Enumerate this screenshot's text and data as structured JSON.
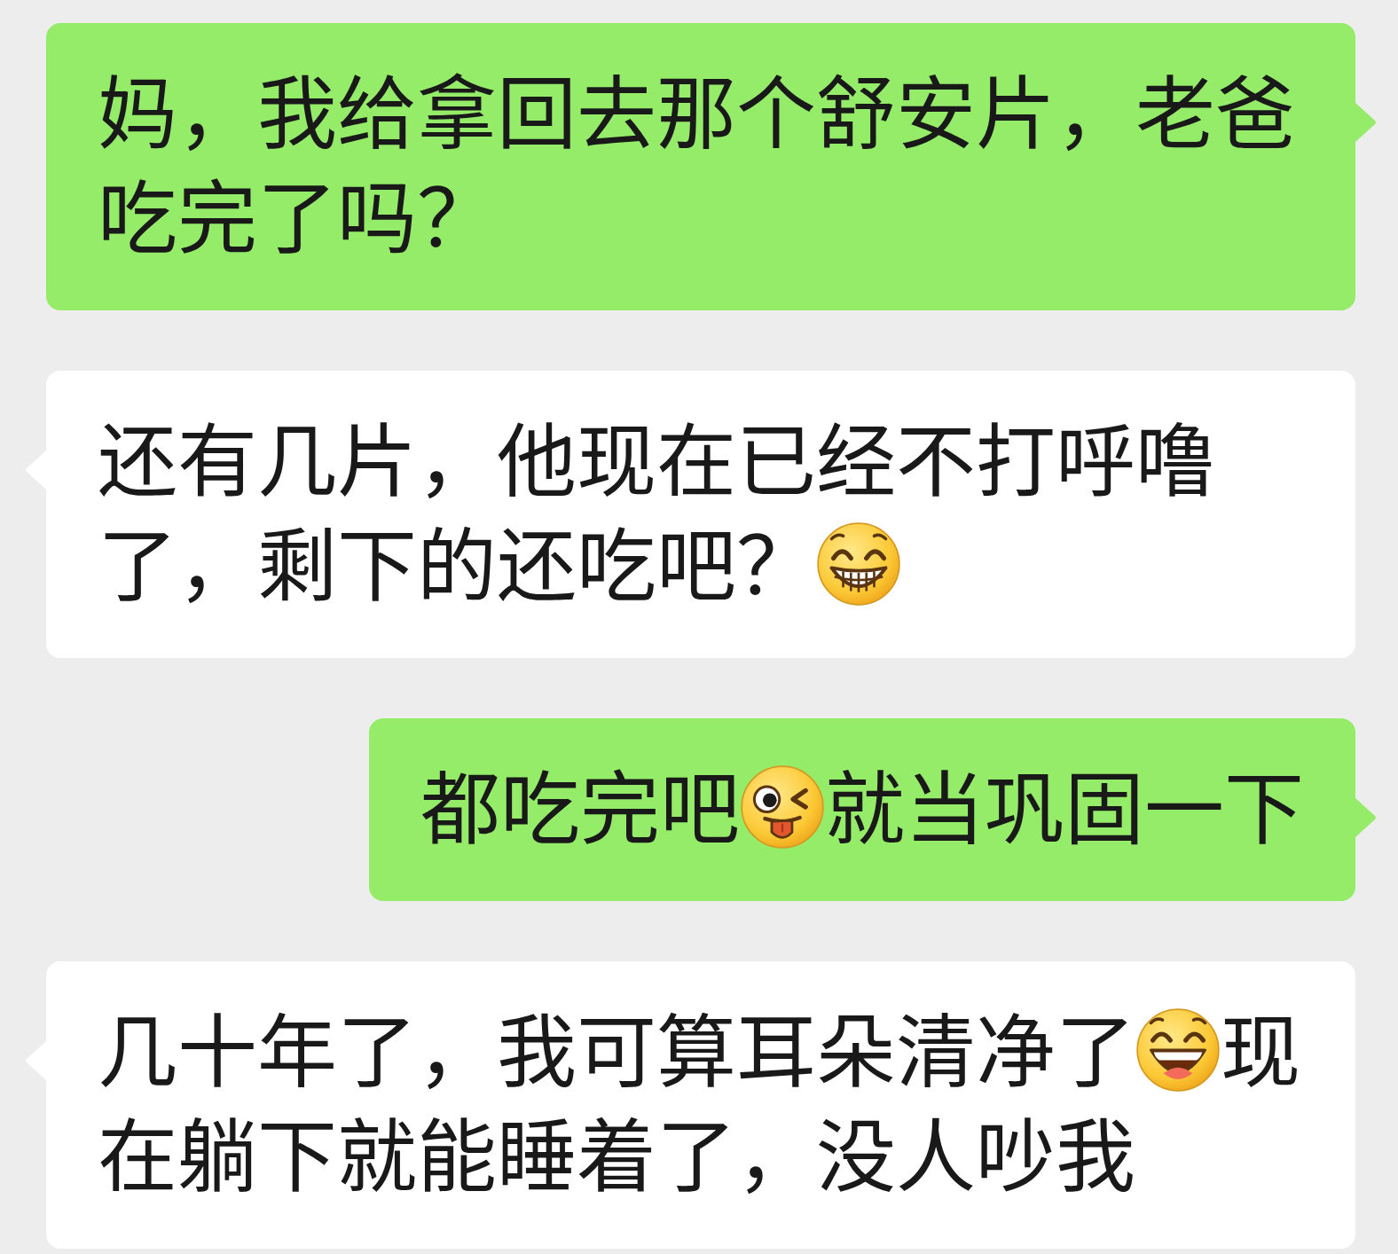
{
  "messages": [
    {
      "outgoing": true,
      "parts": [
        {
          "kind": "text",
          "text": "妈，我给拿回去那个舒安片，老爸吃完了吗？"
        }
      ]
    },
    {
      "outgoing": false,
      "parts": [
        {
          "kind": "text",
          "text": "还有几片，他现在已经不打呼噜了，剩下的还吃吧？"
        },
        {
          "kind": "grin"
        }
      ]
    },
    {
      "outgoing": true,
      "parts": [
        {
          "kind": "text",
          "text": "都吃完吧"
        },
        {
          "kind": "wink"
        },
        {
          "kind": "text",
          "text": "就当巩固一下"
        }
      ]
    },
    {
      "outgoing": false,
      "parts": [
        {
          "kind": "text",
          "text": "几十年了，我可算耳朵清净了"
        },
        {
          "kind": "laugh"
        },
        {
          "kind": "text",
          "text": "现在躺下就能睡着了，没人吵我"
        }
      ]
    }
  ]
}
